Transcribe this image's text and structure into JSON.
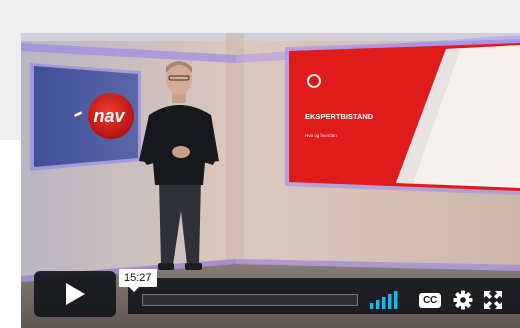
{
  "video": {
    "left_screen_logo_text": "nav",
    "slide_title": "EKSPERTBISTAND",
    "slide_subtitle": "Hva og hvordan"
  },
  "controls": {
    "current_time": "15:27",
    "cc_label": "CC",
    "progress_fraction": 0.0
  },
  "colors": {
    "nav_red": "#e4231c",
    "slide_red": "#e01b1b",
    "control_bg": "#14161a",
    "volume_blue": "#1ab7ea"
  },
  "icons": [
    "play-icon",
    "volume-icon",
    "settings-icon",
    "fullscreen-icon"
  ]
}
